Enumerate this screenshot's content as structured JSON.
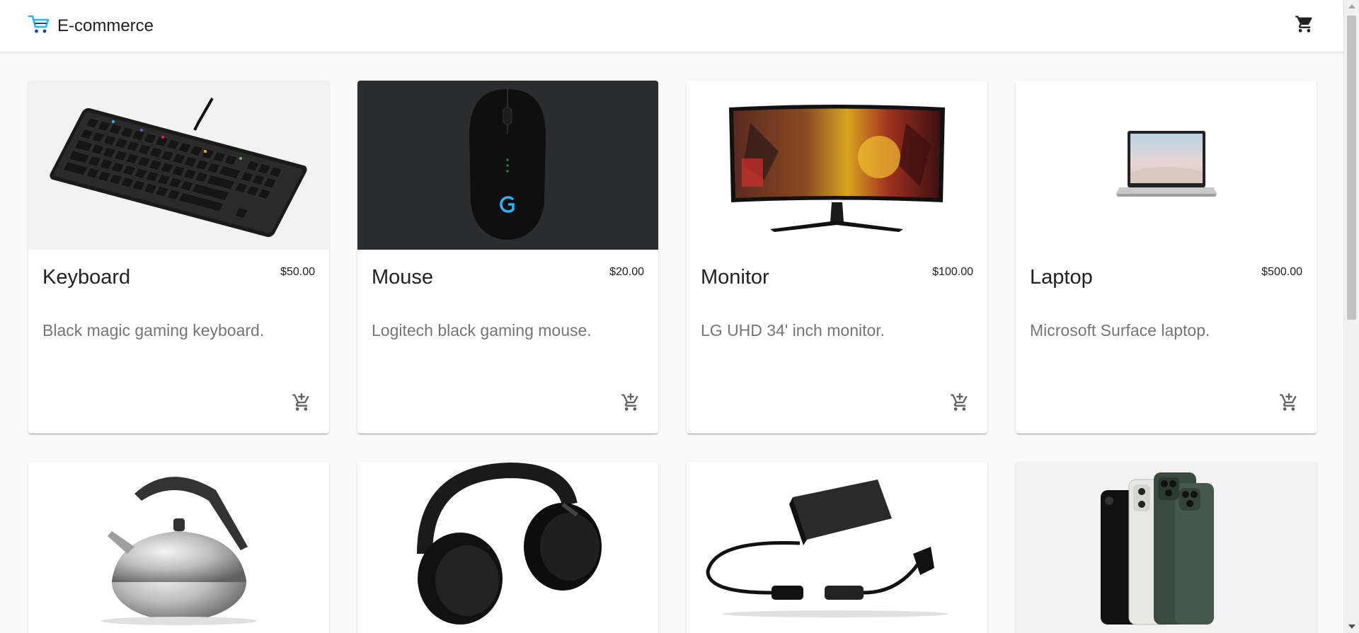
{
  "header": {
    "brand": "E-commerce",
    "logo_icon": "shopping-cart-icon",
    "cart_icon": "cart-icon"
  },
  "colors": {
    "accent": "#29b6f6",
    "title_text": "#212121",
    "desc_text": "#757575"
  },
  "products": [
    {
      "title": "Keyboard",
      "price": "$50.00",
      "description": "Black magic gaming keyboard.",
      "image_icon": "keyboard-image"
    },
    {
      "title": "Mouse",
      "price": "$20.00",
      "description": "Logitech black gaming mouse.",
      "image_icon": "mouse-image"
    },
    {
      "title": "Monitor",
      "price": "$100.00",
      "description": "LG UHD 34' inch monitor.",
      "image_icon": "monitor-image"
    },
    {
      "title": "Laptop",
      "price": "$500.00",
      "description": "Microsoft Surface laptop.",
      "image_icon": "laptop-image"
    },
    {
      "image_icon": "kettle-image"
    },
    {
      "image_icon": "headphones-image"
    },
    {
      "image_icon": "charger-image"
    },
    {
      "image_icon": "phones-image"
    }
  ],
  "add_to_cart_icon": "add-shopping-cart-icon"
}
